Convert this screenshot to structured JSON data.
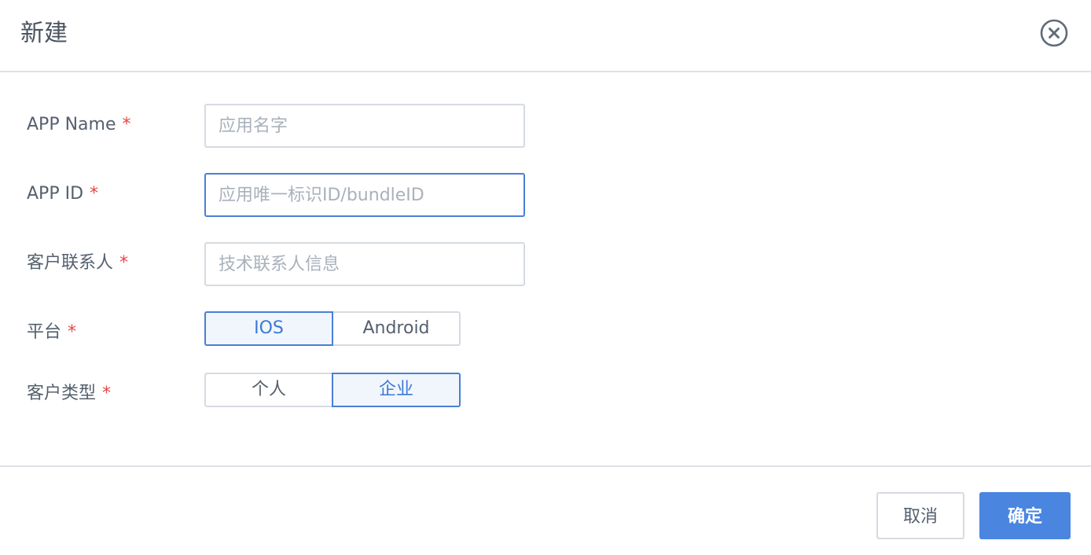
{
  "dialog": {
    "title": "新建",
    "close_icon": "close-circle-icon"
  },
  "form": {
    "required_mark": "*",
    "app_name": {
      "label": "APP Name",
      "value": "",
      "placeholder": "应用名字"
    },
    "app_id": {
      "label": "APP ID",
      "value": "",
      "placeholder": "应用唯一标识ID/bundleID",
      "focused": true
    },
    "contact": {
      "label": "客户联系人",
      "value": "",
      "placeholder": "技术联系人信息"
    },
    "platform": {
      "label": "平台",
      "options": [
        "IOS",
        "Android"
      ],
      "selected": "IOS"
    },
    "customer_type": {
      "label": "客户类型",
      "options": [
        "个人",
        "企业"
      ],
      "selected": "企业"
    }
  },
  "footer": {
    "cancel_label": "取消",
    "ok_label": "确定"
  },
  "colors": {
    "accent": "#4a86e0",
    "required": "#e64545",
    "border": "#d6dbe1",
    "selected_bg": "#f1f6fd"
  }
}
